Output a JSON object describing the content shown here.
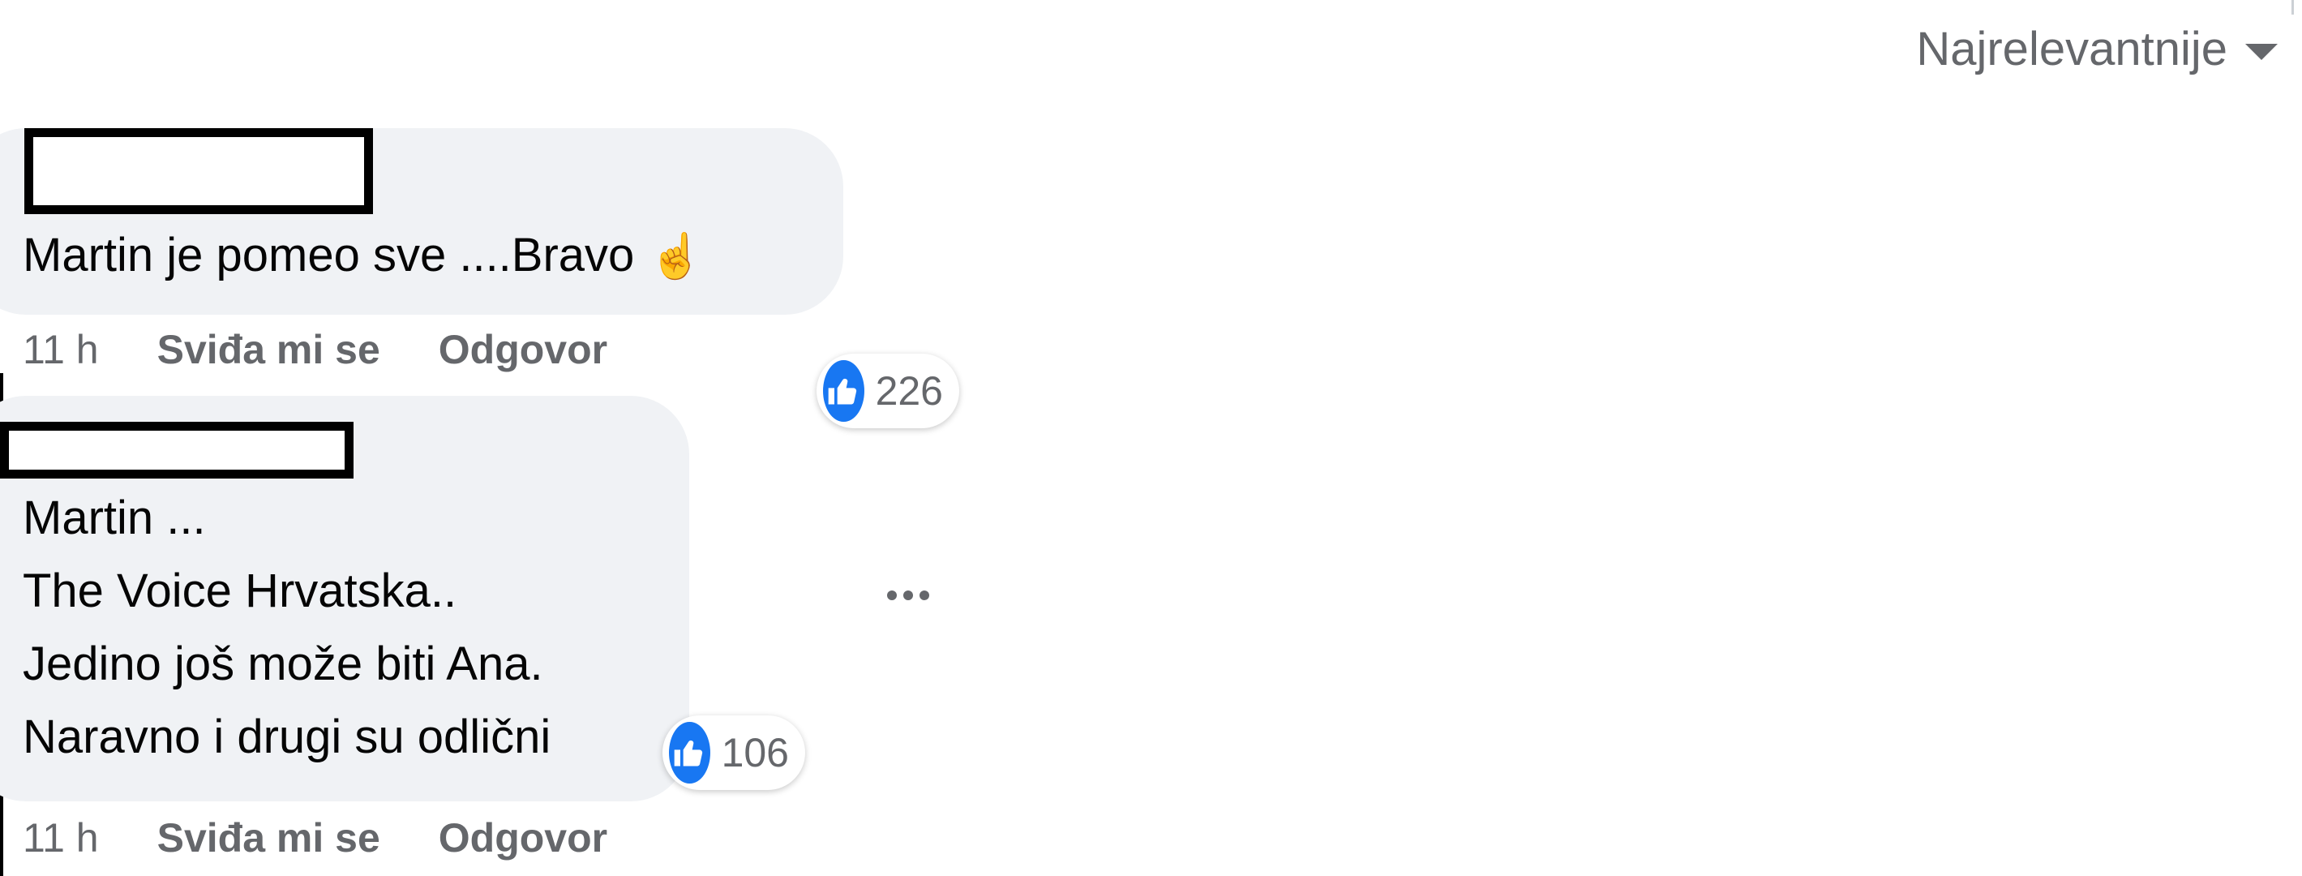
{
  "sort": {
    "label": "Najrelevantnije"
  },
  "comments": [
    {
      "lines": [
        "Martin je pomeo sve ....Bravo"
      ],
      "emoji": "☝",
      "reaction_count": "226",
      "time": "11 h",
      "like_label": "Sviđa mi se",
      "reply_label": "Odgovor"
    },
    {
      "lines": [
        "Martin ...",
        "The Voice Hrvatska..",
        "Jedino još može biti Ana.",
        "Naravno i drugi su odlični"
      ],
      "reaction_count": "106",
      "time": "11 h",
      "like_label": "Sviđa mi se",
      "reply_label": "Odgovor"
    }
  ],
  "colors": {
    "like_blue": "#1877f2",
    "bubble_bg": "#f0f2f5",
    "secondary_text": "#65676b"
  }
}
